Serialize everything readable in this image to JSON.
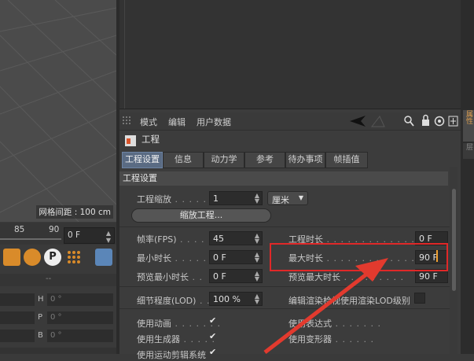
{
  "viewport": {
    "grid_spacing": "网格间距 : 100 cm"
  },
  "timeline": {
    "ruler_85": "85",
    "ruler_90": "90",
    "frame_field": "0 F"
  },
  "coords": {
    "rows": [
      {
        "axis": "H",
        "value": "0 °"
      },
      {
        "axis": "P",
        "value": "0 °"
      },
      {
        "axis": "B",
        "value": "0 °"
      }
    ],
    "separator": "--"
  },
  "attr": {
    "menu": [
      "模式",
      "编辑",
      "用户数据"
    ],
    "object_name": "工程",
    "tabs": [
      "工程设置",
      "信息",
      "动力学",
      "参考",
      "待办事项",
      "帧插值"
    ],
    "section_title": "工程设置",
    "project_scale": {
      "label": "工程缩放",
      "value": "1",
      "unit": "厘米"
    },
    "scale_button": "缩放工程...",
    "fps": {
      "label": "帧率(FPS)",
      "value": "45"
    },
    "project_length": {
      "label": "工程时长",
      "value": "0 F"
    },
    "min_length": {
      "label": "最小时长",
      "value": "0 F"
    },
    "max_length": {
      "label": "最大时长",
      "value": "90 F"
    },
    "preview_min": {
      "label": "预览最小时长",
      "value": "0 F"
    },
    "preview_max": {
      "label": "预览最大时长",
      "value": "90 F"
    },
    "lod": {
      "label": "细节程度(LOD)",
      "value": "100 %"
    },
    "lod_render": {
      "label": "编辑渲染检视使用渲染LOD级别"
    },
    "use_animation": {
      "label": "使用动画",
      "checked": "✔"
    },
    "use_generators": {
      "label": "使用生成器",
      "checked": "✔"
    },
    "use_motion": {
      "label": "使用运动剪辑系统",
      "checked": "✔"
    },
    "use_expressions": {
      "label": "使用表达式"
    },
    "use_deformers": {
      "label": "使用变形器"
    }
  },
  "right_tabs": {
    "tab1": "属性",
    "tab2": "层"
  },
  "colors": {
    "highlight": "#e02828",
    "active_tab": "#5a6b83",
    "cursor": "#f0a030"
  }
}
